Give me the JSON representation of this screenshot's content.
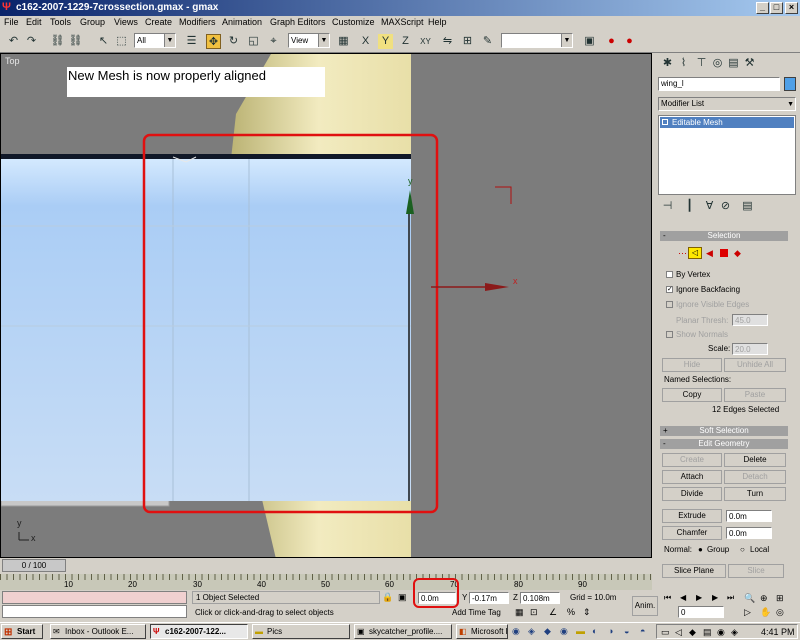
{
  "window": {
    "title": "c162-2007-1229-7crossection.gmax - gmax"
  },
  "menu": [
    "File",
    "Edit",
    "Tools",
    "Group",
    "Views",
    "Create",
    "Modifiers",
    "Animation",
    "Graph Editors",
    "Customize",
    "MAXScript",
    "Help"
  ],
  "toolbar": {
    "selection_filter": "All",
    "ref_coord": "View",
    "named_selection": ""
  },
  "viewport": {
    "label": "Top",
    "note": "New Mesh is now properly aligned",
    "axis_x": "x",
    "axis_y": "y"
  },
  "command_panel": {
    "object_name": "wing_l",
    "modifier_list": "Modifier List",
    "stack_item": "Editable Mesh",
    "selection": {
      "title": "Selection",
      "by_vertex": "By Vertex",
      "ignore_backfacing": "Ignore Backfacing",
      "ignore_visible_edges": "Ignore Visible Edges",
      "planar_thresh_label": "Planar Thresh:",
      "planar_thresh_value": "45.0",
      "show_normals": "Show Normals",
      "scale_label": "Scale:",
      "scale_value": "20.0",
      "hide": "Hide",
      "unhide_all": "Unhide All",
      "named_selections": "Named Selections:",
      "copy": "Copy",
      "paste": "Paste",
      "status": "12 Edges Selected"
    },
    "soft_selection": {
      "title": "Soft Selection"
    },
    "edit_geometry": {
      "title": "Edit Geometry",
      "create": "Create",
      "delete": "Delete",
      "attach": "Attach",
      "detach": "Detach",
      "divide": "Divide",
      "turn": "Turn",
      "extrude": "Extrude",
      "extrude_value": "0.0m",
      "chamfer": "Chamfer",
      "chamfer_value": "0.0m",
      "normal_label": "Normal:",
      "group": "Group",
      "local": "Local",
      "slice_plane": "Slice Plane",
      "slice": "Slice"
    }
  },
  "timeline": {
    "frame": "0 / 100",
    "ticks": [
      "10",
      "20",
      "30",
      "40",
      "50",
      "60",
      "70",
      "80",
      "90"
    ]
  },
  "status": {
    "selected": "1 Object Selected",
    "prompt": "Click or click-and-drag to select objects",
    "x": "0.0m",
    "y_label": "Y",
    "y": "-0.17m",
    "z_label": "Z",
    "z": "0.108m",
    "grid": "Grid = 10.0m",
    "add_time_tag": "Add Time Tag",
    "anim": "Anim.",
    "frame_field": "0"
  },
  "taskbar": {
    "start": "Start",
    "tasks": [
      "Inbox - Outlook E...",
      "c162-2007-122...",
      "Pics",
      "skycatcher_profile....",
      "Microsoft Power..."
    ],
    "time": "4:41 PM"
  }
}
